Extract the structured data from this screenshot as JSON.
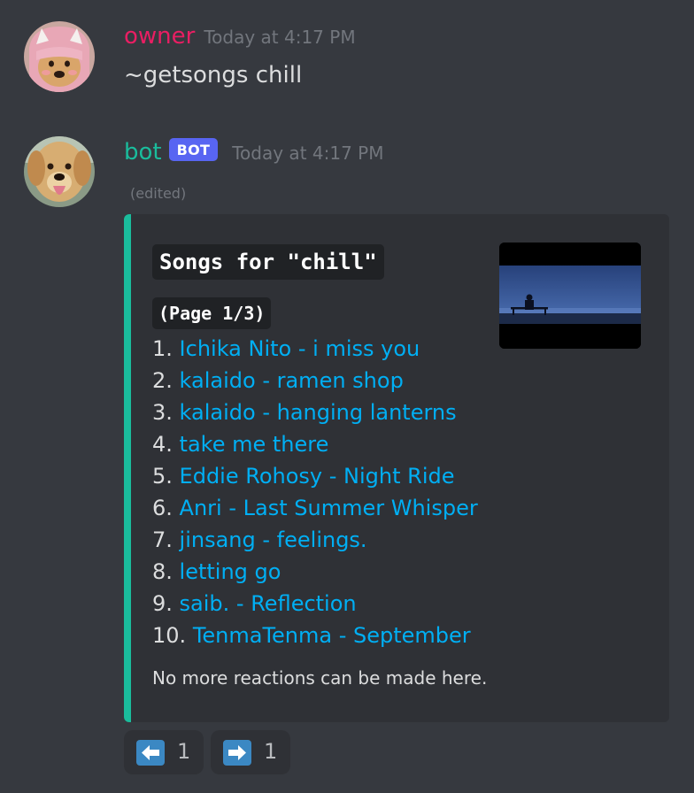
{
  "messages": [
    {
      "username": "owner",
      "username_color": "#e91e63",
      "timestamp": "Today at 4:17 PM",
      "content": "~getsongs chill",
      "avatar": "anime-dog-avatar"
    },
    {
      "username": "bot",
      "username_color": "#1abc9c",
      "bot_tag": "BOT",
      "timestamp": "Today at 4:17 PM",
      "edited": "(edited)",
      "avatar": "golden-retriever-avatar"
    }
  ],
  "embed": {
    "accent_color": "#1abc9c",
    "title": "Songs for \"chill\"",
    "page_label": "(Page 1/3)",
    "songs": [
      {
        "num": "1.",
        "title": "Ichika Nito - i miss you"
      },
      {
        "num": "2.",
        "title": "kalaido - ramen shop"
      },
      {
        "num": "3.",
        "title": "kalaido - hanging lanterns"
      },
      {
        "num": "4.",
        "title": "take me there"
      },
      {
        "num": "5.",
        "title": "Eddie Rohosy - Night Ride"
      },
      {
        "num": "6.",
        "title": "Anri - Last Summer Whisper"
      },
      {
        "num": "7.",
        "title": "jinsang - feelings."
      },
      {
        "num": "8.",
        "title": "letting go"
      },
      {
        "num": "9.",
        "title": "saib. - Reflection"
      },
      {
        "num": "10.",
        "title": "TenmaTenma - September"
      }
    ],
    "footer": "No more reactions can be made here.",
    "thumbnail": "man-on-bench-night-thumbnail"
  },
  "reactions": [
    {
      "emoji": "left-arrow-icon",
      "count": "1"
    },
    {
      "emoji": "right-arrow-icon",
      "count": "1"
    }
  ]
}
